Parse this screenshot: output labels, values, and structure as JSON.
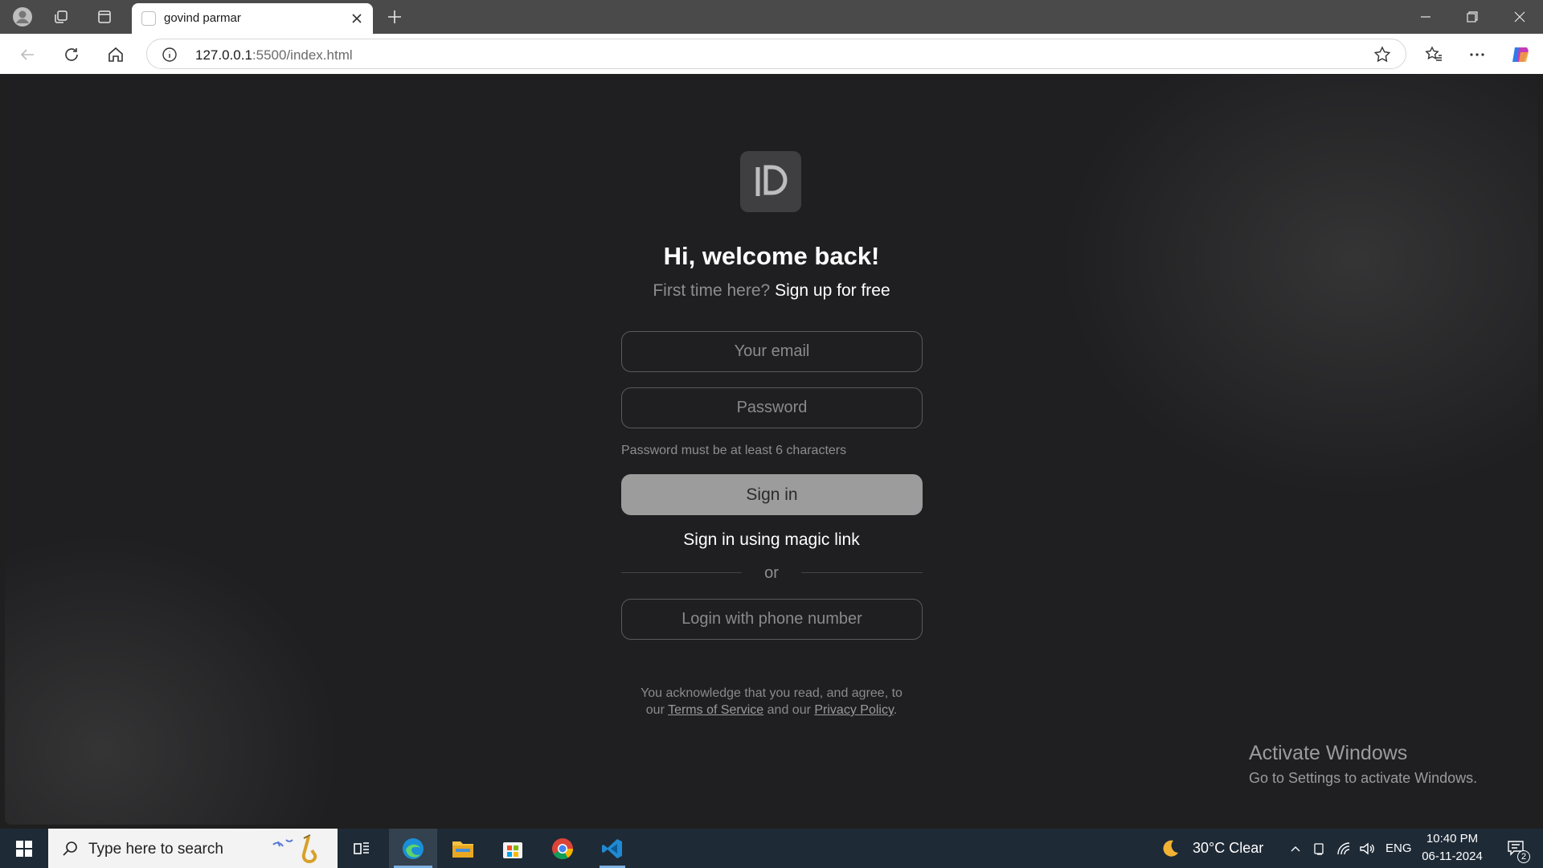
{
  "browser": {
    "tab_title": "govind parmar",
    "address_host": "127.0.0.1",
    "address_rest": ":5500/index.html"
  },
  "login": {
    "heading": "Hi, welcome back!",
    "subline_prefix": "First time here?",
    "signup_link": "Sign up for free",
    "email_placeholder": "Your email",
    "password_placeholder": "Password",
    "password_hint": "Password must be at least 6 characters",
    "signin_label": "Sign in",
    "magic_link_label": "Sign in using magic link",
    "divider_text": "or",
    "phone_login_label": "Login with phone number",
    "legal_line1": "You acknowledge that you read, and agree, to",
    "legal_our": "our",
    "terms_link": "Terms of Service",
    "legal_and": "and our",
    "privacy_link": "Privacy Policy",
    "legal_end": "."
  },
  "watermark": {
    "title": "Activate Windows",
    "subtitle": "Go to Settings to activate Windows."
  },
  "taskbar": {
    "search_placeholder": "Type here to search",
    "weather": "30°C  Clear",
    "language": "ENG",
    "time": "10:40 PM",
    "date": "06-11-2024",
    "notification_count": "2"
  },
  "colors": {
    "page_bg": "#1f1f21",
    "signin_button": "#9c9c9c",
    "taskbar_bg": "#1e2a36"
  }
}
